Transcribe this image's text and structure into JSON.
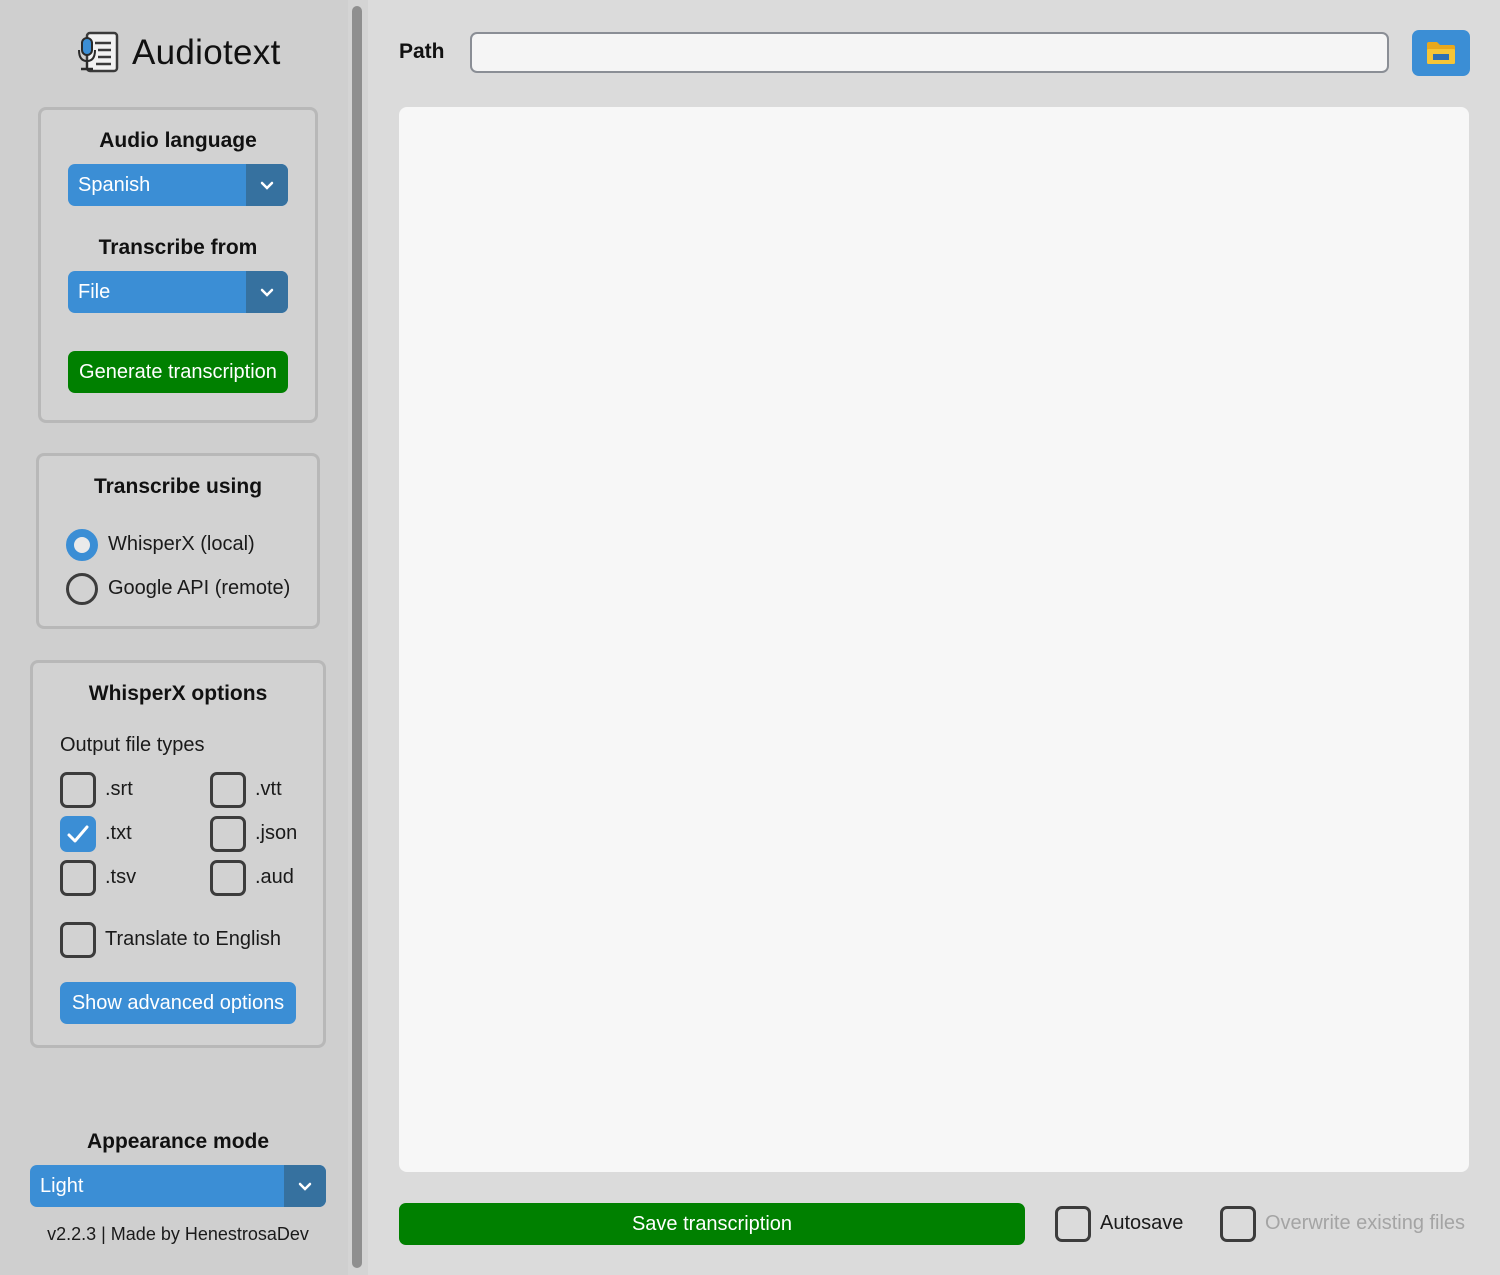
{
  "app": {
    "title": "Audiotext"
  },
  "audio_language": {
    "title": "Audio language",
    "selected": "Spanish"
  },
  "transcribe_from": {
    "title": "Transcribe from",
    "selected": "File"
  },
  "generate_button": "Generate transcription",
  "transcribe_using": {
    "title": "Transcribe using",
    "options": [
      {
        "label": "WhisperX (local)",
        "selected": true
      },
      {
        "label": "Google API (remote)",
        "selected": false
      }
    ]
  },
  "whisperx_options": {
    "title": "WhisperX options",
    "output_label": "Output file types",
    "file_types": [
      {
        "label": ".srt",
        "checked": false
      },
      {
        "label": ".vtt",
        "checked": false
      },
      {
        "label": ".txt",
        "checked": true
      },
      {
        "label": ".json",
        "checked": false
      },
      {
        "label": ".tsv",
        "checked": false
      },
      {
        "label": ".aud",
        "checked": false
      }
    ],
    "translate": {
      "label": "Translate to English",
      "checked": false
    },
    "advanced_button": "Show advanced options"
  },
  "appearance": {
    "title": "Appearance mode",
    "selected": "Light"
  },
  "footer": "v2.2.3 | Made by HenestrosaDev",
  "main": {
    "path_label": "Path",
    "path_value": "",
    "transcription_text": "",
    "save_button": "Save transcription",
    "autosave": {
      "label": "Autosave",
      "checked": false
    },
    "overwrite": {
      "label": "Overwrite existing files",
      "checked": false,
      "disabled": true
    }
  },
  "colors": {
    "accent": "#3b8ed5",
    "accent_dark": "#36719f",
    "green": "#008000"
  }
}
